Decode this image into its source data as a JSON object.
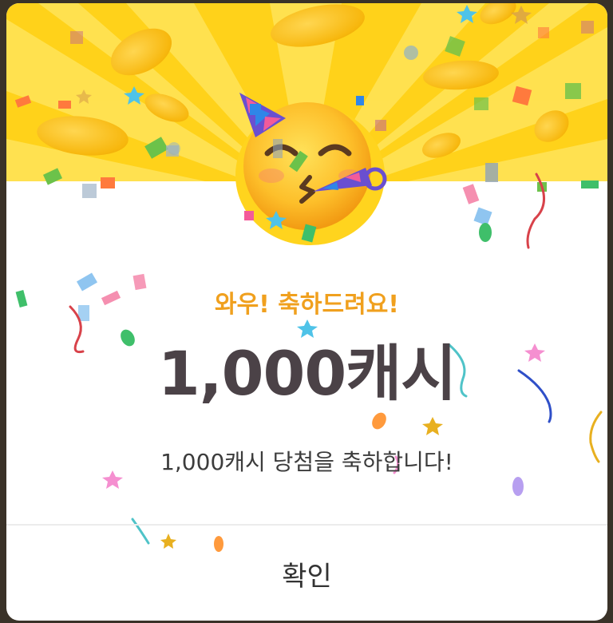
{
  "dialog": {
    "title": "와우! 축하드려요!",
    "amount": "1,000캐시",
    "message": "1,000캐시 당첨을 축하합니다!",
    "confirm_label": "확인"
  },
  "icons": {
    "celebration": "party-face-emoji",
    "coins": "gold-coin-icon",
    "confetti": "confetti"
  },
  "colors": {
    "banner": "#ffd21a",
    "title": "#f0a01e",
    "amount": "#4b4247",
    "background_dim": "#3a3228"
  }
}
